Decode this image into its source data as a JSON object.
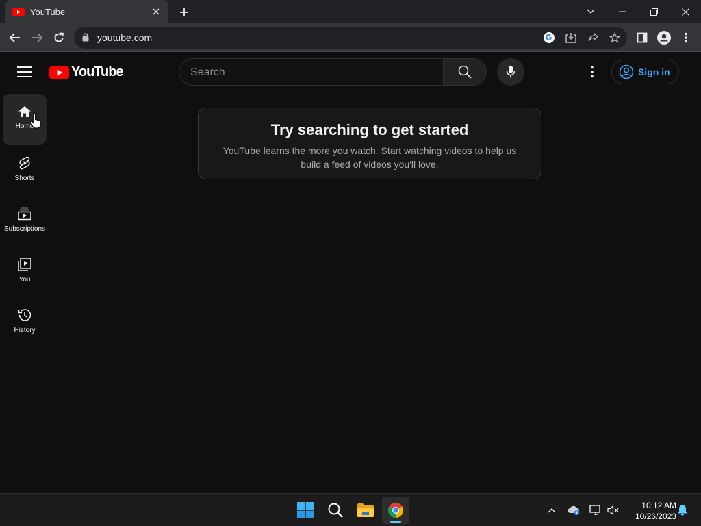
{
  "browser": {
    "tab_title": "YouTube",
    "url": "youtube.com"
  },
  "header": {
    "logo_text": "YouTube",
    "search_placeholder": "Search",
    "signin_label": "Sign in"
  },
  "sidebar": {
    "items": [
      {
        "label": "Home",
        "icon": "home-icon",
        "active": true
      },
      {
        "label": "Shorts",
        "icon": "shorts-icon"
      },
      {
        "label": "Subscriptions",
        "icon": "subscriptions-icon"
      },
      {
        "label": "You",
        "icon": "you-icon"
      },
      {
        "label": "History",
        "icon": "history-icon"
      }
    ]
  },
  "main": {
    "prompt_title": "Try searching to get started",
    "prompt_text": "YouTube learns the more you watch. Start watching videos to help us build a feed of videos you'll love."
  },
  "taskbar": {
    "time": "10:12 AM",
    "date": "10/26/2023"
  },
  "colors": {
    "brand_red": "#ff0000",
    "link_blue": "#3ea6ff",
    "background": "#0f0f0f"
  }
}
